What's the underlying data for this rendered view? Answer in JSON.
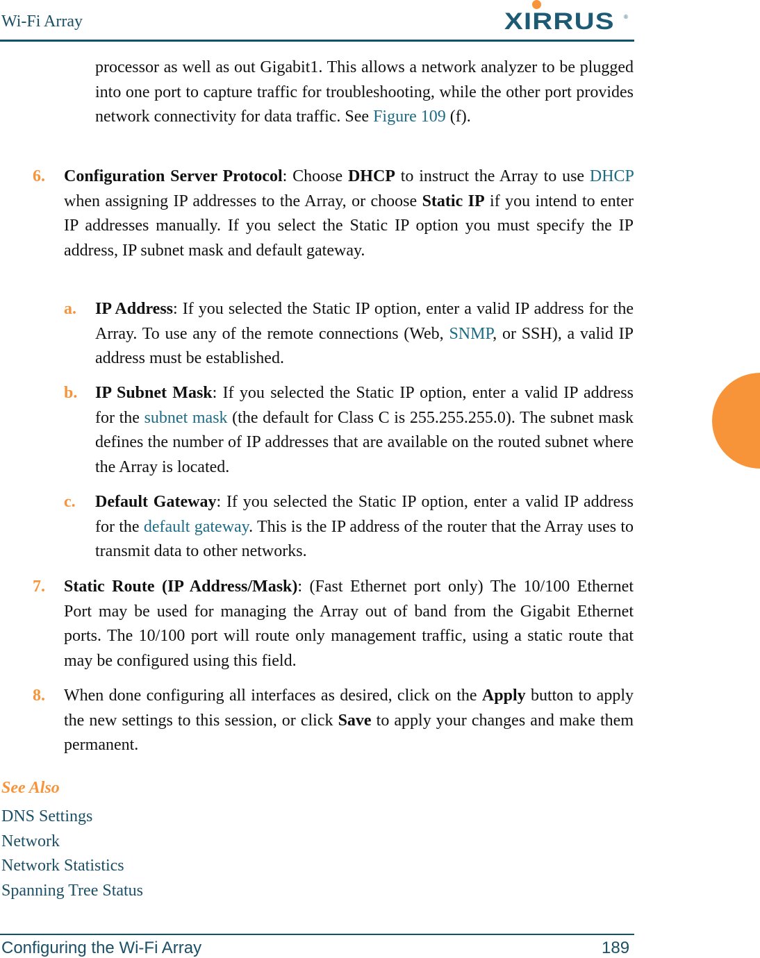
{
  "header": {
    "title": "Wi-Fi Array",
    "logo_text": "XIRRUS",
    "logo_registered": "®"
  },
  "colors": {
    "brand_teal": "#1d5a74",
    "accent_orange": "#f7943a",
    "link": "#1d6b84"
  },
  "intro": {
    "text_before_link": "processor as well as out Gigabit1. This allows a network analyzer to be plugged into one port to capture traffic for troubleshooting, while the other port provides network connectivity for data traffic. See ",
    "link": "Figure 109",
    "text_after_link": " (f)."
  },
  "items": {
    "item6": {
      "num": "6.",
      "term": "Configuration Server Protocol",
      "t1": ": Choose ",
      "b1": "DHCP",
      "t2": " to instruct the Array to use ",
      "link": "DHCP",
      "t3": " when assigning IP addresses to the Array, or choose ",
      "b2": "Static IP",
      "t4": " if you intend to enter IP addresses manually. If you select the Static IP option you must specify the IP address, IP subnet mask and default gateway."
    },
    "a": {
      "num": "a.",
      "term": "IP Address",
      "t1": ": If you selected the Static IP option, enter a valid IP address for the Array. To use any of the remote connections (Web, ",
      "link": "SNMP",
      "t2": ", or SSH), a valid IP address must be established."
    },
    "b": {
      "num": "b.",
      "term": "IP Subnet Mask",
      "t1": ": If you selected the Static IP option, enter a valid IP address for the ",
      "link": "subnet mask",
      "t2": " (the default for Class C is 255.255.255.0). The subnet mask defines the number of IP addresses that are available on the routed subnet where the Array is located."
    },
    "c": {
      "num": "c.",
      "term": "Default Gateway",
      "t1": ": If you selected the Static IP option, enter a valid IP address for the ",
      "link": "default gateway",
      "t2": ". This is the IP address of the router that the Array uses to transmit data to other networks."
    },
    "item7": {
      "num": "7.",
      "term": "Static Route (IP Address/Mask)",
      "t1": ": (Fast Ethernet port only) The 10/100 Ethernet Port may be used for managing the Array out of band from the Gigabit Ethernet ports. The 10/100 port will route only management traffic, using a static route that may be configured using this field."
    },
    "item8": {
      "num": "8.",
      "t1": "When done configuring all interfaces as desired, click on the ",
      "b1": "Apply",
      "t2": " button to apply the new settings to this session, or click ",
      "b2": "Save",
      "t3": " to apply your changes and make them permanent."
    }
  },
  "see_also": {
    "title": "See Also",
    "links": [
      "DNS Settings",
      "Network",
      "Network Statistics",
      "Spanning Tree Status"
    ]
  },
  "footer": {
    "section": "Configuring the Wi-Fi Array",
    "page_number": "189"
  }
}
